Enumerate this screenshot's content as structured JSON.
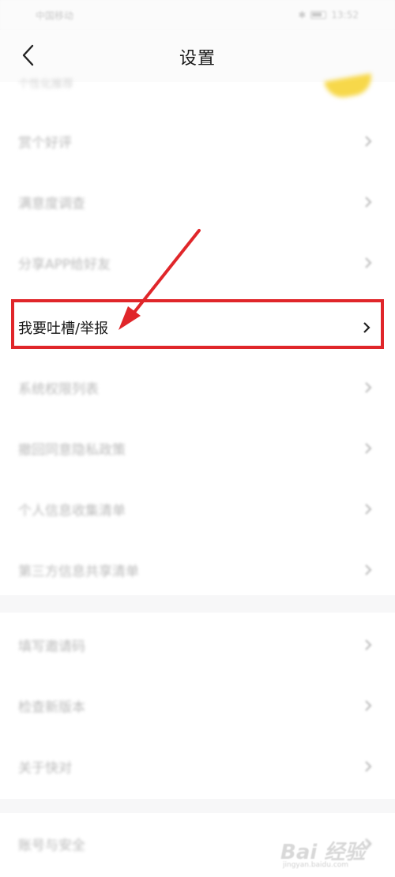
{
  "status_bar": {
    "carrier": "中国移动",
    "signal": "⁴ᴳ ᵃˡ ⁵ᴳ",
    "time": "13:52"
  },
  "header": {
    "title": "设置",
    "back_icon": "chevron-left-icon"
  },
  "partial_item": {
    "label": "个性化推荐"
  },
  "group1": {
    "items": [
      {
        "label": "赏个好评"
      },
      {
        "label": "满意度调查"
      },
      {
        "label": "分享APP给好友"
      },
      {
        "label": "我要吐槽/举报"
      },
      {
        "label": "系统权限列表"
      },
      {
        "label": "撤回同意隐私政策"
      },
      {
        "label": "个人信息收集清单"
      },
      {
        "label": "第三方信息共享清单"
      }
    ]
  },
  "group2": {
    "items": [
      {
        "label": "填写邀请码"
      },
      {
        "label": "检查新版本"
      },
      {
        "label": "关于快对"
      }
    ]
  },
  "group3": {
    "items": [
      {
        "label": "账号与安全"
      }
    ]
  },
  "annotation": {
    "highlight_color": "#e0262a"
  },
  "watermark": {
    "text": "Bai 经验",
    "sub": "jingyan.baidu.com"
  }
}
